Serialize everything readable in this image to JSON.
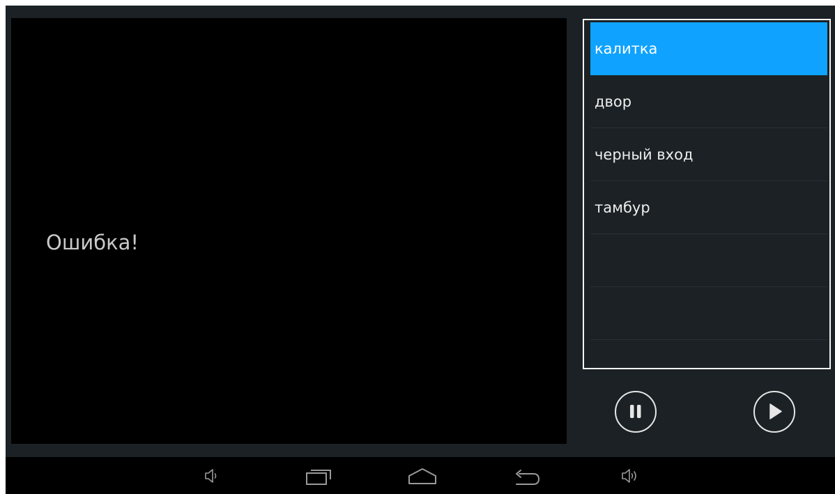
{
  "video": {
    "message": "Ошибка!"
  },
  "camera_list": {
    "items": [
      {
        "label": "калитка",
        "selected": true
      },
      {
        "label": "двор",
        "selected": false
      },
      {
        "label": "черный вход",
        "selected": false
      },
      {
        "label": "тамбур",
        "selected": false
      },
      {
        "label": "",
        "selected": false
      },
      {
        "label": "",
        "selected": false
      }
    ]
  },
  "controls": {
    "pause_icon": "pause-icon",
    "play_icon": "play-icon"
  },
  "nav_bar": {
    "icons": [
      "volume-down-icon",
      "recent-apps-icon",
      "home-icon",
      "back-icon",
      "volume-up-icon"
    ]
  },
  "colors": {
    "accent": "#0fa3ff",
    "background": "#1b2125",
    "video_background": "#000000",
    "nav_bar": "#000000"
  }
}
